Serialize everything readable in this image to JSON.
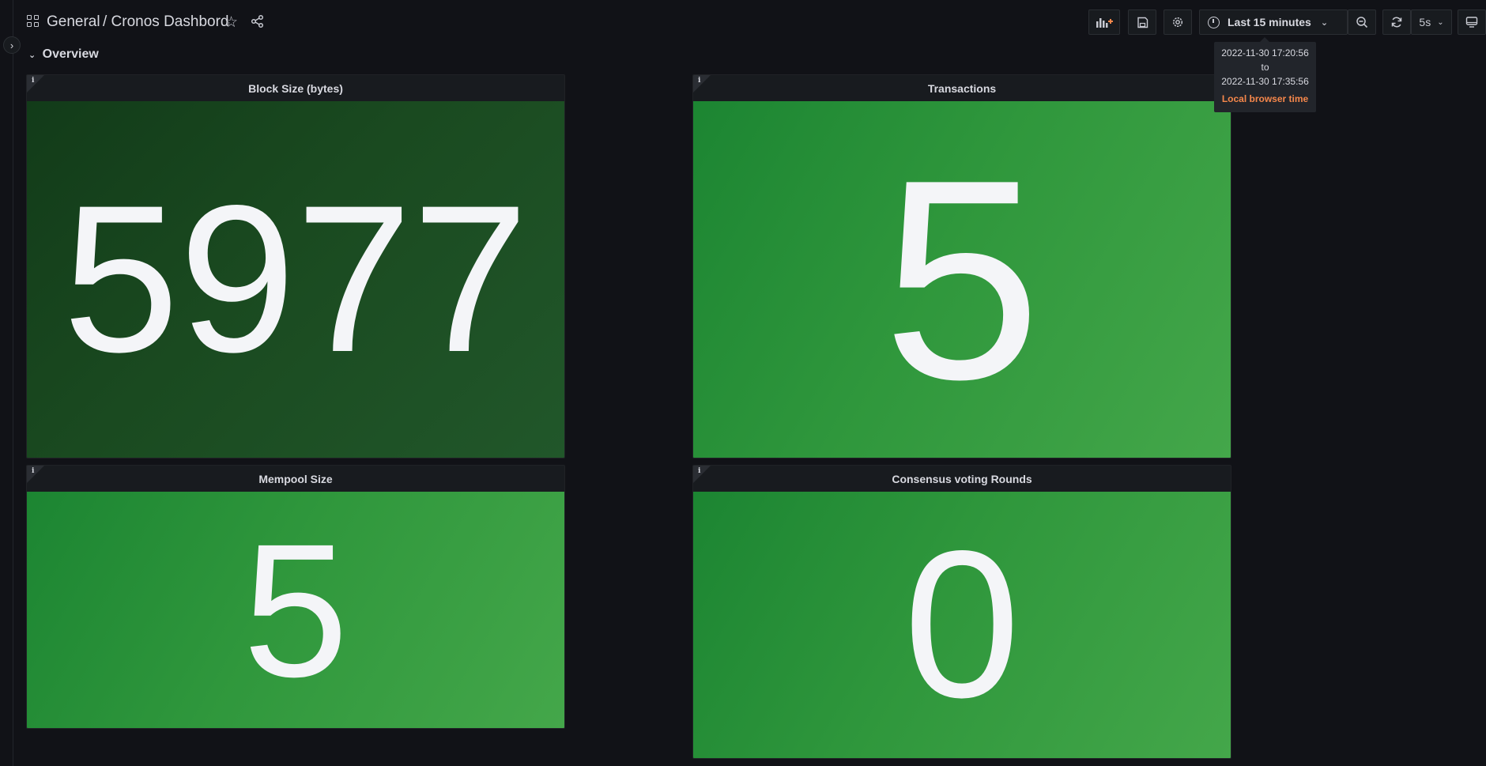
{
  "breadcrumb": {
    "folder": "General",
    "dashboard": "/ Cronos Dashbord"
  },
  "icons": {
    "apps": "grid-icon",
    "star": "star-icon",
    "share": "share-icon",
    "add_panel": "add-panel-icon",
    "save": "save-icon",
    "settings": "gear-icon",
    "time": "clock-icon",
    "zoom_out": "zoom-out-icon",
    "refresh": "refresh-icon",
    "tv_mode": "monitor-icon",
    "expand": "chevron-right-icon"
  },
  "time_picker": {
    "label": "Last 15 minutes",
    "tooltip_from": "2022-11-30 17:20:56",
    "tooltip_to_word": "to",
    "tooltip_to": "2022-11-30 17:35:56",
    "tooltip_timezone": "Local browser time"
  },
  "refresh": {
    "interval": "5s"
  },
  "row": {
    "title": "Overview"
  },
  "panels": [
    {
      "title": "Block Size (bytes)",
      "value": "5977",
      "info": "i"
    },
    {
      "title": "Transactions",
      "value": "5",
      "info": "i"
    },
    {
      "title": "Mempool Size",
      "value": "5",
      "info": "i"
    },
    {
      "title": "Consensus voting Rounds",
      "value": "0",
      "info": "i"
    }
  ],
  "colors": {
    "background": "#111217",
    "panel_dark_green": "#1a4a20",
    "panel_green": "#2f973c",
    "accent_orange": "#f5874b",
    "text": "#d8d9e0"
  }
}
